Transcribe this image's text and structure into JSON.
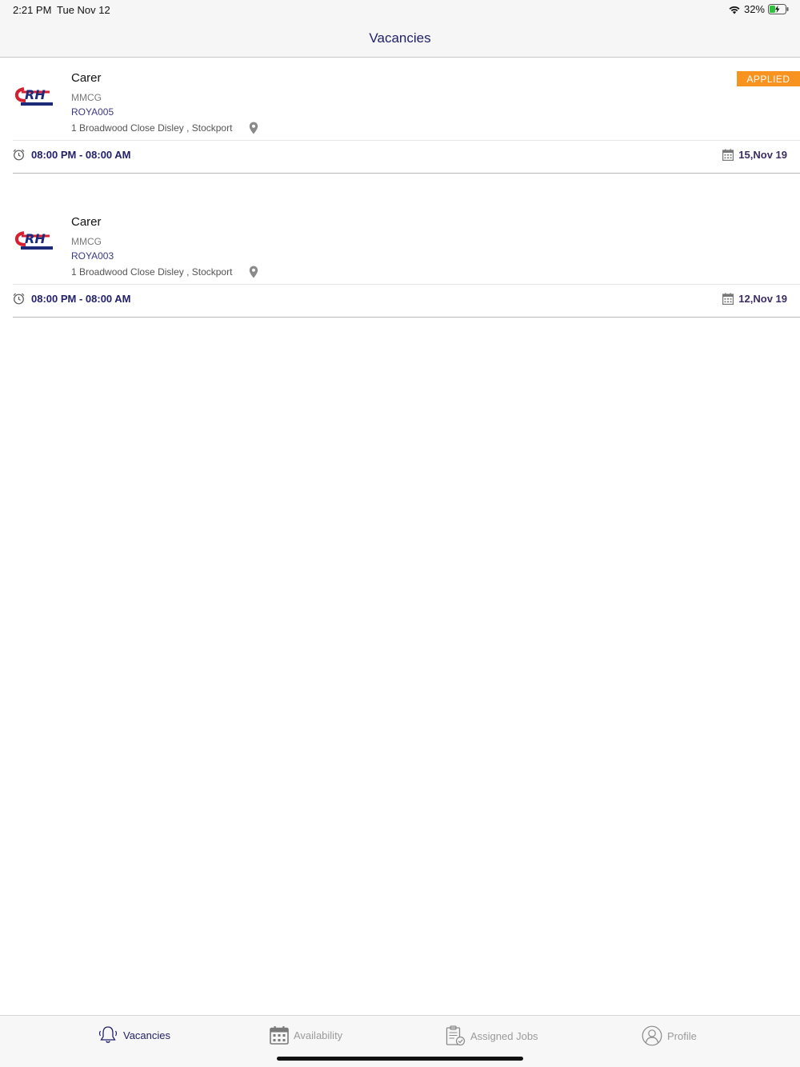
{
  "status_bar": {
    "time": "2:21 PM",
    "date": "Tue Nov 12",
    "battery": "32%"
  },
  "nav": {
    "title": "Vacancies"
  },
  "colors": {
    "accent": "#22206b",
    "badge": "#f7931e"
  },
  "vacancies": [
    {
      "title": "Carer",
      "company": "MMCG",
      "code": "ROYA005",
      "address": "1 Broadwood Close Disley , Stockport",
      "badge": "APPLIED",
      "time_range": "08:00 PM - 08:00 AM",
      "date": "15,Nov 19"
    },
    {
      "title": "Carer",
      "company": "MMCG",
      "code": "ROYA003",
      "address": "1 Broadwood Close Disley , Stockport",
      "badge": "",
      "time_range": "08:00 PM - 08:00 AM",
      "date": "12,Nov 19"
    }
  ],
  "tabs": [
    {
      "label": "Vacancies",
      "icon": "bell-icon",
      "active": true
    },
    {
      "label": "Availability",
      "icon": "calendar-icon",
      "active": false
    },
    {
      "label": "Assigned Jobs",
      "icon": "clipboard-icon",
      "active": false
    },
    {
      "label": "Profile",
      "icon": "user-icon",
      "active": false
    }
  ]
}
